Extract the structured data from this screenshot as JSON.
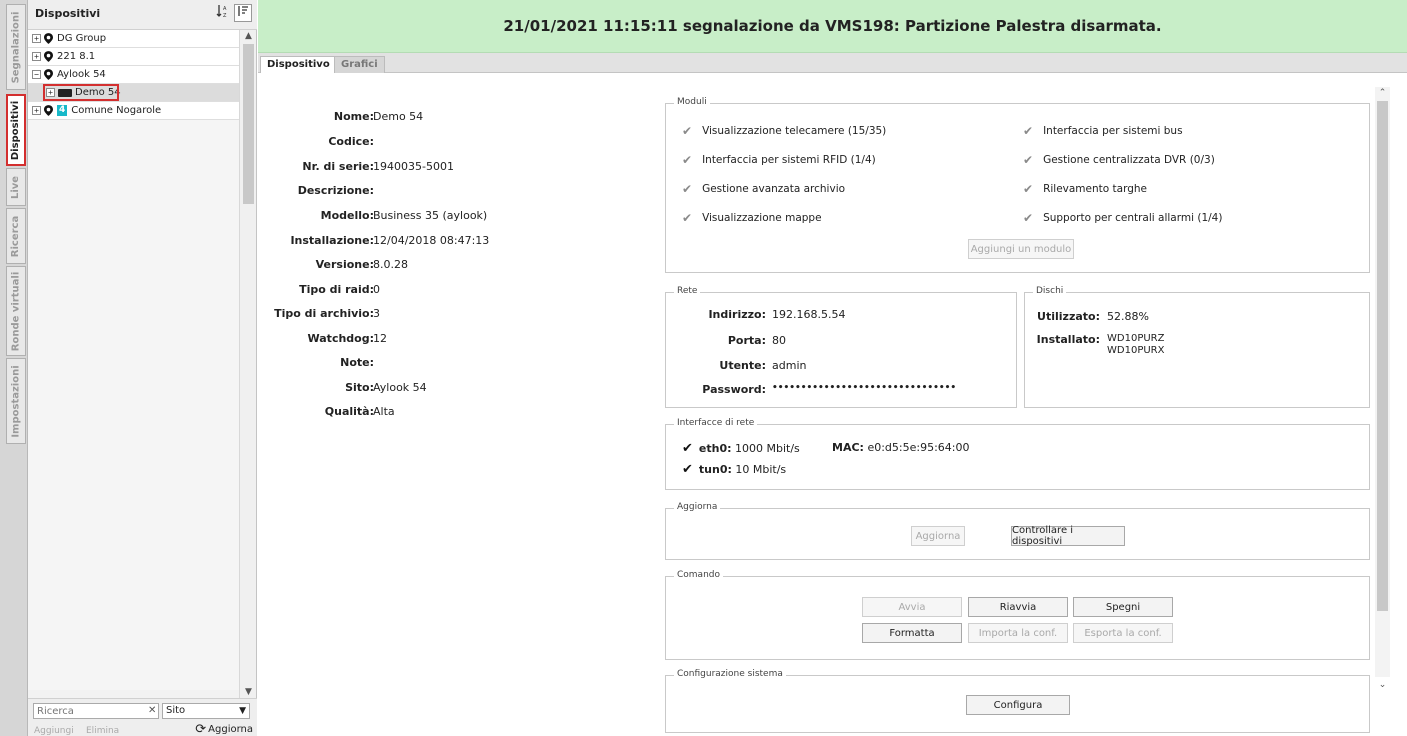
{
  "sidebar_tabs": [
    "Segnalazioni",
    "Dispositivi",
    "Live",
    "Ricerca",
    "Ronde virtuali",
    "Impostazioni"
  ],
  "tree": {
    "title": "Dispositivi",
    "sort_alpha_icon": "↓A Z",
    "sort_custom_icon": "sort-list-icon",
    "items": [
      {
        "label": "DG Group",
        "expander": "+"
      },
      {
        "label": "221 8.1",
        "expander": "+"
      },
      {
        "label": "Aylook 54",
        "expander": "−"
      },
      {
        "label": "Demo 54",
        "expander": "+"
      },
      {
        "label": "Comune Nogarole",
        "expander": "+",
        "badge": "4"
      }
    ],
    "search_placeholder": "Ricerca",
    "filter_value": "Sito",
    "add_label": "Aggiungi",
    "delete_label": "Elimina",
    "refresh_label": "Aggiorna"
  },
  "banner": "21/01/2021 11:15:11 segnalazione da VMS198: Partizione Palestra disarmata.",
  "tabs": [
    "Dispositivo",
    "Grafici"
  ],
  "device": [
    {
      "label": "Nome:",
      "value": "Demo 54"
    },
    {
      "label": "Codice:",
      "value": ""
    },
    {
      "label": "Nr. di serie:",
      "value": "1940035-5001"
    },
    {
      "label": "Descrizione:",
      "value": ""
    },
    {
      "label": "Modello:",
      "value": "Business 35 (aylook)"
    },
    {
      "label": "Installazione:",
      "value": "12/04/2018 08:47:13"
    },
    {
      "label": "Versione:",
      "value": "8.0.28"
    },
    {
      "label": "Tipo di raid:",
      "value": "0"
    },
    {
      "label": "Tipo di archivio:",
      "value": "3"
    },
    {
      "label": "Watchdog:",
      "value": "12"
    },
    {
      "label": "Note:",
      "value": ""
    },
    {
      "label": "Sito:",
      "value": "Aylook 54"
    },
    {
      "label": "Qualità:",
      "value": "Alta"
    }
  ],
  "modules": {
    "legend": "Moduli",
    "left": [
      "Visualizzazione telecamere (15/35)",
      "Interfaccia per sistemi RFID (1/4)",
      "Gestione avanzata archivio",
      "Visualizzazione mappe"
    ],
    "right": [
      "Interfaccia per sistemi bus",
      "Gestione centralizzata DVR (0/3)",
      "Rilevamento targhe",
      "Supporto per centrali allarmi (1/4)"
    ],
    "add_button": "Aggiungi un modulo"
  },
  "network": {
    "legend": "Rete",
    "address_label": "Indirizzo:",
    "address": "192.168.5.54",
    "port_label": "Porta:",
    "port": "80",
    "user_label": "Utente:",
    "user": "admin",
    "password_label": "Password:",
    "password": "••••••••••••••••••••••••••••••••"
  },
  "disks": {
    "legend": "Dischi",
    "used_label": "Utilizzato:",
    "used": "52.88%",
    "installed_label": "Installato:",
    "installed": [
      "WD10PURZ",
      "WD10PURX"
    ]
  },
  "interfaces": {
    "legend": "Interfacce di rete",
    "eth0_label": "eth0:",
    "eth0": "1000 Mbit/s",
    "mac_label": "MAC:",
    "mac": "e0:d5:5e:95:64:00",
    "tun0_label": "tun0:",
    "tun0": "10 Mbit/s"
  },
  "update": {
    "legend": "Aggiorna",
    "update_button": "Aggiorna",
    "check_button": "Controllare i dispositivi"
  },
  "command": {
    "legend": "Comando",
    "start": "Avvia",
    "restart": "Riavvia",
    "shutdown": "Spegni",
    "format": "Formatta",
    "import": "Importa la conf.",
    "export": "Esporta la conf."
  },
  "sysconfig": {
    "legend": "Configurazione sistema",
    "configure": "Configura"
  }
}
